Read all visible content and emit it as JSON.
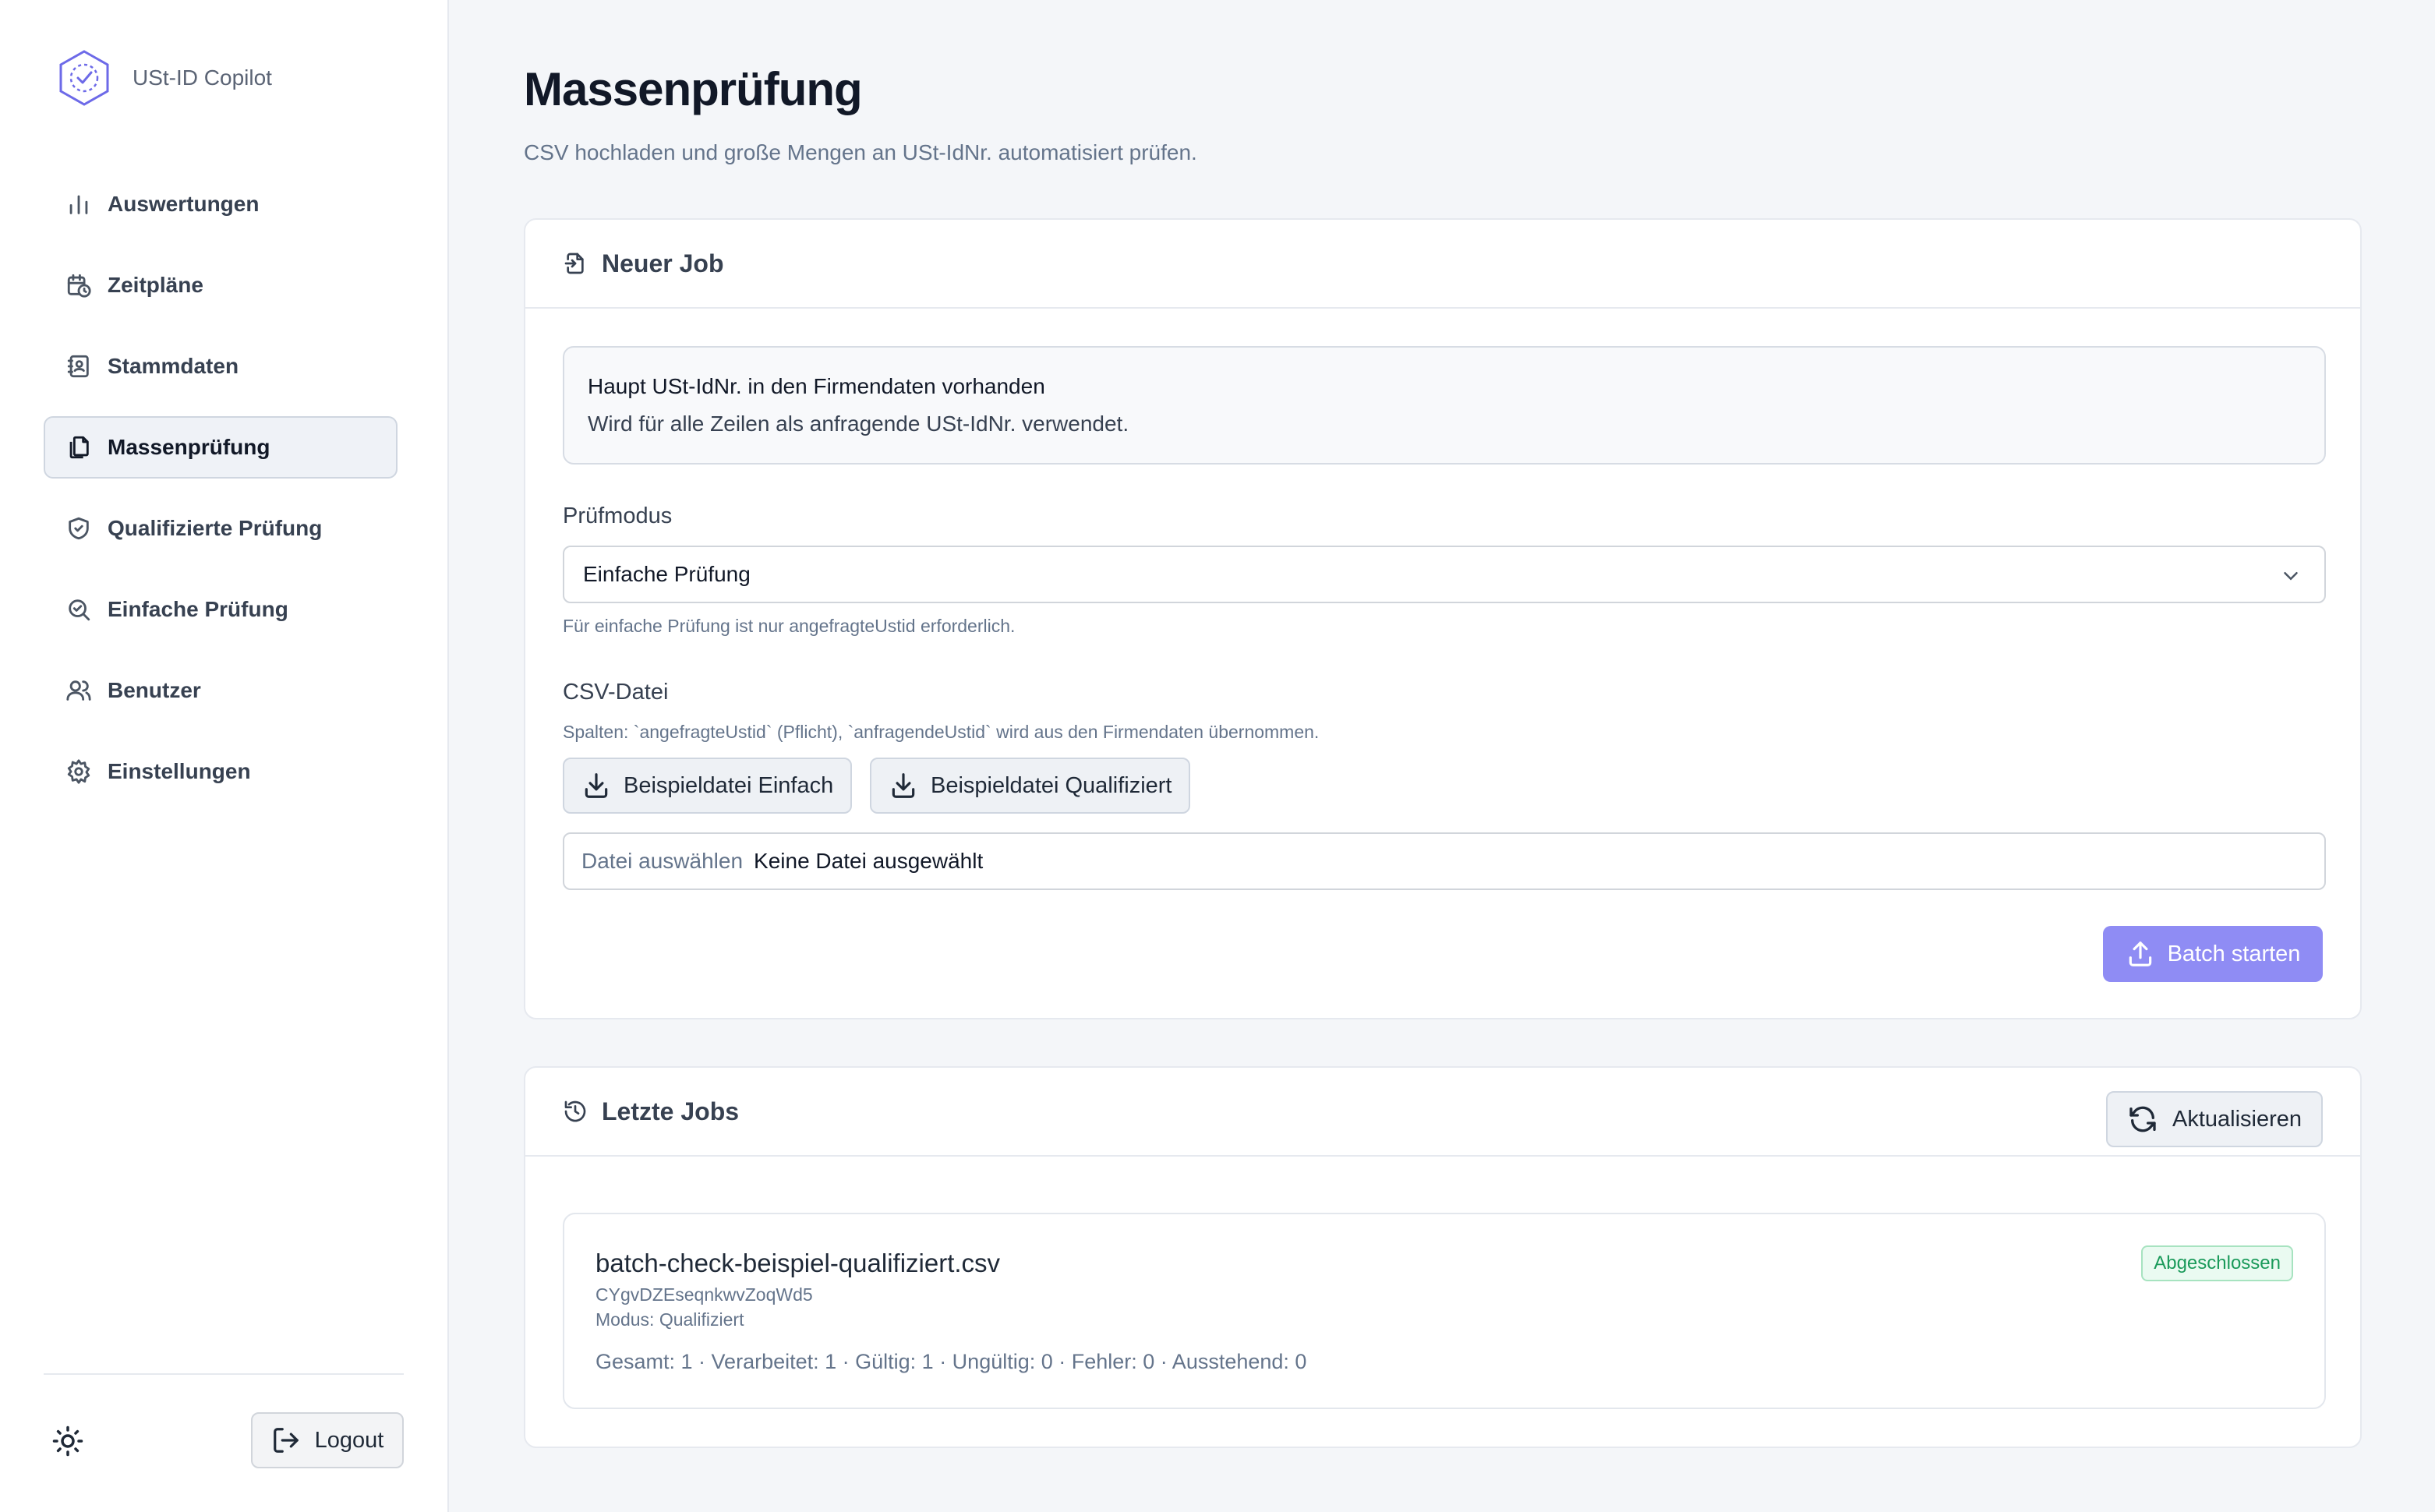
{
  "app": {
    "name": "USt-ID Copilot"
  },
  "sidebar": {
    "items": [
      {
        "label": "Auswertungen",
        "icon": "bar-chart-icon"
      },
      {
        "label": "Zeitpläne",
        "icon": "calendar-clock-icon"
      },
      {
        "label": "Stammdaten",
        "icon": "contact-book-icon"
      },
      {
        "label": "Massenprüfung",
        "icon": "files-icon",
        "active": true
      },
      {
        "label": "Qualifizierte Prüfung",
        "icon": "shield-check-icon"
      },
      {
        "label": "Einfache Prüfung",
        "icon": "search-check-icon"
      },
      {
        "label": "Benutzer",
        "icon": "users-icon"
      },
      {
        "label": "Einstellungen",
        "icon": "gear-icon"
      }
    ],
    "logout_label": "Logout"
  },
  "page": {
    "title": "Massenprüfung",
    "subtitle": "CSV hochladen und große Mengen an USt-IdNr. automatisiert prüfen."
  },
  "new_job": {
    "title": "Neuer Job",
    "info_title": "Haupt USt-IdNr. in den Firmendaten vorhanden",
    "info_text": "Wird für alle Zeilen als anfragende USt-IdNr. verwendet.",
    "mode_label": "Prüfmodus",
    "mode_value": "Einfache Prüfung",
    "mode_hint": "Für einfache Prüfung ist nur angefragteUstid erforderlich.",
    "csv_label": "CSV-Datei",
    "csv_hint": "Spalten: `angefragteUstid` (Pflicht), `anfragendeUstid` wird aus den Firmendaten übernommen.",
    "example_simple_label": "Beispieldatei Einfach",
    "example_qualified_label": "Beispieldatei Qualifiziert",
    "file_button_label": "Datei auswählen",
    "file_status": "Keine Datei ausgewählt",
    "start_label": "Batch starten"
  },
  "recent_jobs": {
    "title": "Letzte Jobs",
    "refresh_label": "Aktualisieren",
    "items": [
      {
        "name": "batch-check-beispiel-qualifiziert.csv",
        "id": "CYgvDZEseqnkwvZoqWd5",
        "mode": "Modus: Qualifiziert",
        "stats": "Gesamt: 1 · Verarbeitet: 1 · Gültig: 1 · Ungültig: 0 · Fehler: 0 · Ausstehend: 0",
        "status": "Abgeschlossen"
      }
    ]
  },
  "colors": {
    "accent": "#8f8cf4",
    "success": "#1a9a5a",
    "brand_logo": "#6d6ae8"
  }
}
